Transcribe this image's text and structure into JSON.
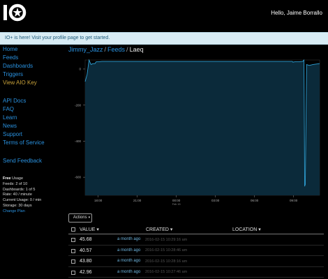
{
  "header": {
    "greeting": "Hello, Jaime Borrallo",
    "logo_text": "IO"
  },
  "banner": {
    "text": "IO+ is here! Visit your profile page to get started."
  },
  "sidebar": {
    "nav": [
      "Home",
      "Feeds",
      "Dashboards",
      "Triggers",
      "View AIO Key"
    ],
    "docs": [
      "API Docs",
      "FAQ",
      "Learn",
      "News",
      "Support",
      "Terms of Service"
    ],
    "feedback": "Send Feedback",
    "usage": {
      "plan": "Free",
      "plan_suffix": " Usage",
      "feeds": "Feeds: 2 of 10",
      "dashboards": "Dashboards: 1 of 5",
      "rate": "Rate: 40 / minute",
      "current": "Current Usage: 0 / min",
      "storage": "Storage: 30 days",
      "change_plan": "Change Plan"
    }
  },
  "breadcrumb": {
    "user": "Jimmy_Jazz",
    "section": "Feeds",
    "current": "Laeq"
  },
  "chart_data": {
    "type": "area",
    "title": "",
    "xlabel": "",
    "ylabel": "",
    "ylim": [
      -700,
      50
    ],
    "yticks": [
      0,
      -200,
      -400,
      -600
    ],
    "xticks": [
      "18:00",
      "21:00",
      "00:00",
      "03:00",
      "06:00",
      "09:00"
    ],
    "x_sub_label": "Feb 15",
    "fill_color": "#0b2a3a",
    "line_color": "#2ea1d6",
    "series": [
      {
        "x": [
          0,
          0.15,
          0.3,
          0.45,
          0.6,
          0.75,
          0.85,
          1.05,
          1.3,
          1.6,
          2,
          3,
          4,
          5,
          6,
          7,
          8,
          9,
          10,
          11,
          12,
          13,
          14,
          15,
          15.5,
          15.9,
          15.95,
          16.1,
          16.4,
          16.7,
          16.8,
          16.85,
          16.9,
          17.0,
          17.2,
          17.5,
          17.8,
          18.0
        ],
        "y": [
          -70,
          -30,
          50,
          25,
          30,
          30,
          40,
          40,
          42,
          42,
          42,
          42,
          42,
          42,
          42,
          42,
          42,
          42,
          42,
          42,
          42,
          42,
          42,
          42,
          42,
          42,
          38,
          40,
          40,
          42,
          50,
          -650,
          -640,
          25,
          20,
          25,
          28,
          30
        ]
      }
    ]
  },
  "actions": {
    "label": "Actions"
  },
  "table": {
    "columns": [
      "VALUE",
      "CREATED",
      "LOCATION"
    ],
    "rows": [
      {
        "value": "45.68",
        "ago": "a month ago",
        "timestamp": "2016-02-15 10:29:16 am"
      },
      {
        "value": "40.57",
        "ago": "a month ago",
        "timestamp": "2016-02-15 10:28:46 am"
      },
      {
        "value": "43.80",
        "ago": "a month ago",
        "timestamp": "2016-02-15 10:28:16 am"
      },
      {
        "value": "42.96",
        "ago": "a month ago",
        "timestamp": "2016-02-15 10:27:46 am"
      }
    ]
  }
}
